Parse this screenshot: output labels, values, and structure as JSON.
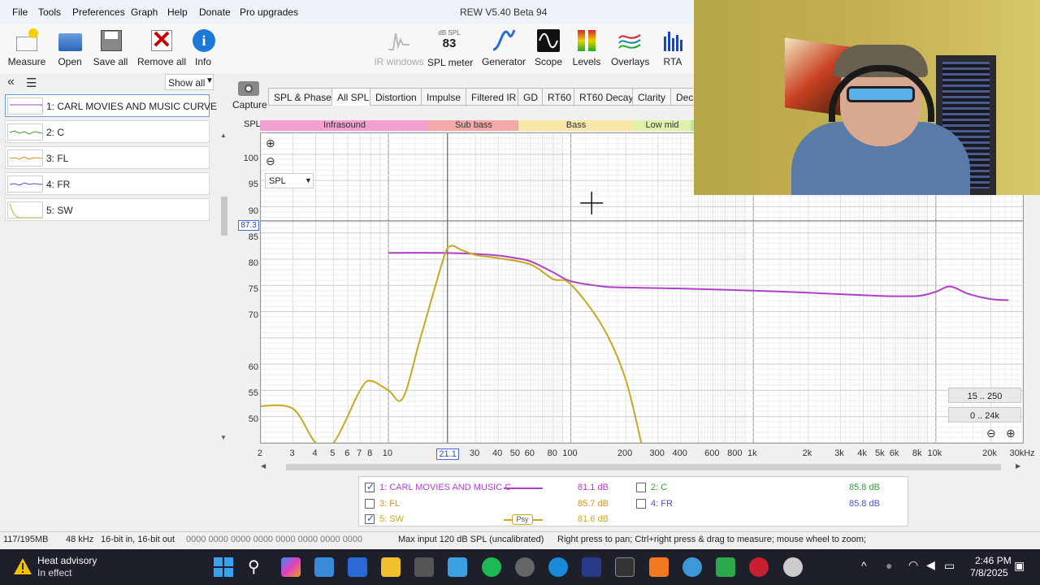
{
  "menu": {
    "items": [
      "File",
      "Tools",
      "Preferences",
      "Graph",
      "Help",
      "Donate",
      "Pro upgrades"
    ],
    "title": "REW V5.40 Beta 94"
  },
  "toolbar": {
    "measure": "Measure",
    "open": "Open",
    "save_all": "Save all",
    "remove_all": "Remove all",
    "info": "Info",
    "ir_windows": "IR windows",
    "spl_meter": "SPL meter",
    "spl_meter_unit": "dB SPL",
    "spl_meter_value": "83",
    "generator": "Generator",
    "scope": "Scope",
    "levels": "Levels",
    "overlays": "Overlays",
    "rta": "RTA"
  },
  "left": {
    "show_all": "Show all",
    "measurements": [
      {
        "label": "1: CARL MOVIES AND MUSIC CURVE",
        "color": "#b040c8"
      },
      {
        "label": "2: C",
        "color": "#3a9a3a"
      },
      {
        "label": "3: FL",
        "color": "#d89020"
      },
      {
        "label": "4: FR",
        "color": "#5050c8"
      },
      {
        "label": "5: SW",
        "color": "#c8a820"
      }
    ]
  },
  "capture": "Capture",
  "tabs": [
    "SPL & Phase",
    "All SPL",
    "Distortion",
    "Impulse",
    "Filtered IR",
    "GD",
    "RT60",
    "RT60 Decay",
    "Clarity",
    "Deca"
  ],
  "graph": {
    "spl_label": "SPL",
    "bands": [
      "Infrasound",
      "Sub bass",
      "Bass",
      "Low mid"
    ],
    "dropdown": "SPL",
    "cursor_value": "87.3",
    "y_ticks": [
      "100",
      "95",
      "90",
      "85",
      "80",
      "75",
      "70",
      "60",
      "55",
      "50"
    ],
    "x_ticks": [
      "2",
      "3",
      "4",
      "5",
      "6",
      "7",
      "8",
      "10",
      "21.1",
      "30",
      "40",
      "50",
      "60",
      "80",
      "100",
      "200",
      "300",
      "400",
      "600",
      "800",
      "1k",
      "2k",
      "3k",
      "4k",
      "5k",
      "6k",
      "8k",
      "10k",
      "20k",
      "30kHz"
    ],
    "range_y": "15 .. 250",
    "range_x": "0 .. 24k"
  },
  "chart_data": {
    "type": "line",
    "xlabel": "",
    "ylabel": "SPL",
    "x_scale": "log",
    "ylim": [
      45,
      104
    ],
    "xlim": [
      2,
      30000
    ],
    "series": [
      {
        "name": "1: CARL MOVIES AND MUSIC CURVE",
        "color": "#b040c8",
        "x": [
          10,
          20,
          30,
          40,
          50,
          60,
          80,
          100,
          150,
          200,
          400,
          1000,
          2000,
          5000,
          8000,
          10000,
          12000,
          15000,
          20000,
          25000
        ],
        "y": [
          81.2,
          81.2,
          81.0,
          80.7,
          80.2,
          79.6,
          77.5,
          75.8,
          74.8,
          74.6,
          74.4,
          74.0,
          73.6,
          73.0,
          73.0,
          73.8,
          74.8,
          73.4,
          72.4,
          72.2
        ]
      },
      {
        "name": "5: SW",
        "color": "#c8a820",
        "x": [
          2,
          3,
          4,
          5,
          7,
          8,
          10,
          12,
          15,
          20,
          22,
          25,
          30,
          40,
          60,
          80,
          100,
          150,
          200,
          250
        ],
        "y": [
          52,
          51.5,
          45,
          45,
          55,
          56.8,
          55,
          53.5,
          65,
          80,
          82.5,
          81.8,
          80.8,
          80.2,
          79,
          76.2,
          75.2,
          67,
          57,
          43
        ]
      }
    ]
  },
  "legend": {
    "items": [
      {
        "label": "1: CARL MOVIES AND MUSIC C",
        "value": "81.1 dB",
        "checked": true,
        "color": "#b040c8"
      },
      {
        "label": "2: C",
        "value": "85.8 dB",
        "checked": false,
        "color": "#3a9a3a"
      },
      {
        "label": "3: FL",
        "value": "85.7 dB",
        "checked": false,
        "color": "#d89020"
      },
      {
        "label": "4: FR",
        "value": "85.8 dB",
        "checked": false,
        "color": "#5050c8"
      },
      {
        "label": "5: SW",
        "value": "81.6 dB",
        "checked": true,
        "color": "#c8a820"
      }
    ],
    "psy": "Psy"
  },
  "status": {
    "memory": "117/195MB",
    "rate": "48 kHz",
    "bits": "16-bit in, 16-bit out",
    "hex": "0000 0000  0000 0000  0000 0000  0000 0000",
    "max_input": "Max input 120 dB SPL (uncalibrated)",
    "hint": "Right press to pan; Ctrl+right press & drag to measure; mouse wheel to zoom;"
  },
  "taskbar": {
    "weather_title": "Heat advisory",
    "weather_sub": "In effect",
    "time": "2:46 PM",
    "date": "7/8/2025",
    "apps": [
      "start-icon",
      "search-icon",
      "copilot-icon",
      "widgets-icon",
      "store-icon",
      "file-explorer-icon",
      "calculator-icon",
      "notepad-icon",
      "spotify-icon",
      "chrome-icon",
      "edge-icon",
      "rew-icon",
      "terminal-icon",
      "vlc-icon",
      "app-icon",
      "app-icon",
      "app-icon",
      "app-icon"
    ]
  }
}
